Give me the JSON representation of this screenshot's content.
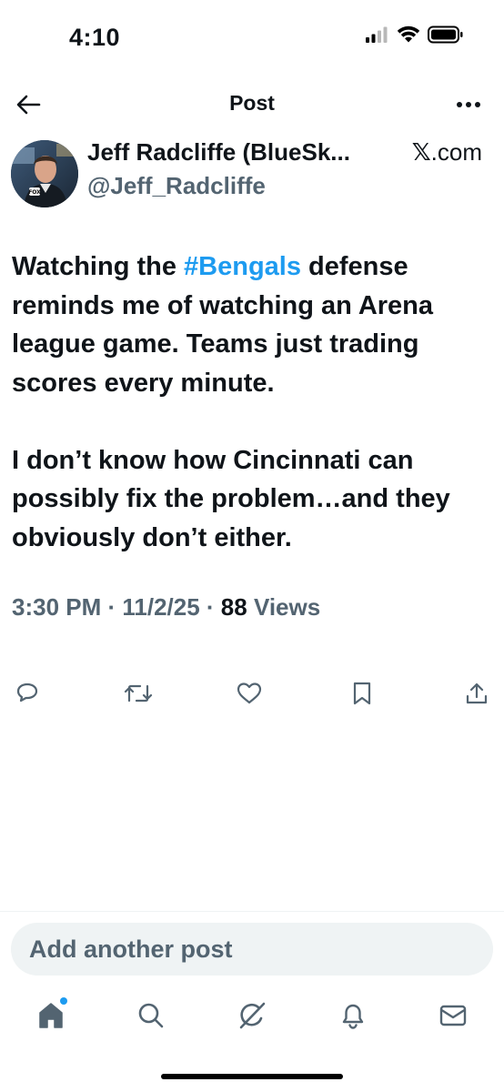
{
  "status_bar": {
    "time": "4:10",
    "signal_icon": "cellular-signal-icon",
    "wifi_icon": "wifi-icon",
    "battery_icon": "battery-icon"
  },
  "header": {
    "title": "Post",
    "back_icon": "back-arrow-icon",
    "more_icon": "more-options-icon"
  },
  "author": {
    "name": "Jeff Radcliffe (BlueSk...",
    "handle": "@Jeff_Radcliffe",
    "source_mark": "𝕏",
    "source_text": ".com"
  },
  "post": {
    "para1_before": "Watching the ",
    "hashtag": "#Bengals",
    "para1_after": " defense reminds me of watching an Arena league game. Teams just trading scores every minute.",
    "para2": "I don’t know how Cincinnati can possibly fix the problem…and they obviously don’t either."
  },
  "meta": {
    "time": "3:30 PM",
    "sep1": " · ",
    "date": "11/2/25",
    "sep2": " · ",
    "views_count": "88",
    "views_label": " Views"
  },
  "actions": [
    "reply-icon",
    "repost-icon",
    "like-icon",
    "bookmark-icon",
    "share-icon"
  ],
  "compose": {
    "placeholder": "Add another post"
  },
  "tabbar": [
    "home-icon",
    "search-icon",
    "grok-icon",
    "notifications-icon",
    "messages-icon"
  ],
  "colors": {
    "accent": "#1d9bf0",
    "text": "#0f1419",
    "secondary": "#536471",
    "compose_bg": "#eff3f4"
  }
}
